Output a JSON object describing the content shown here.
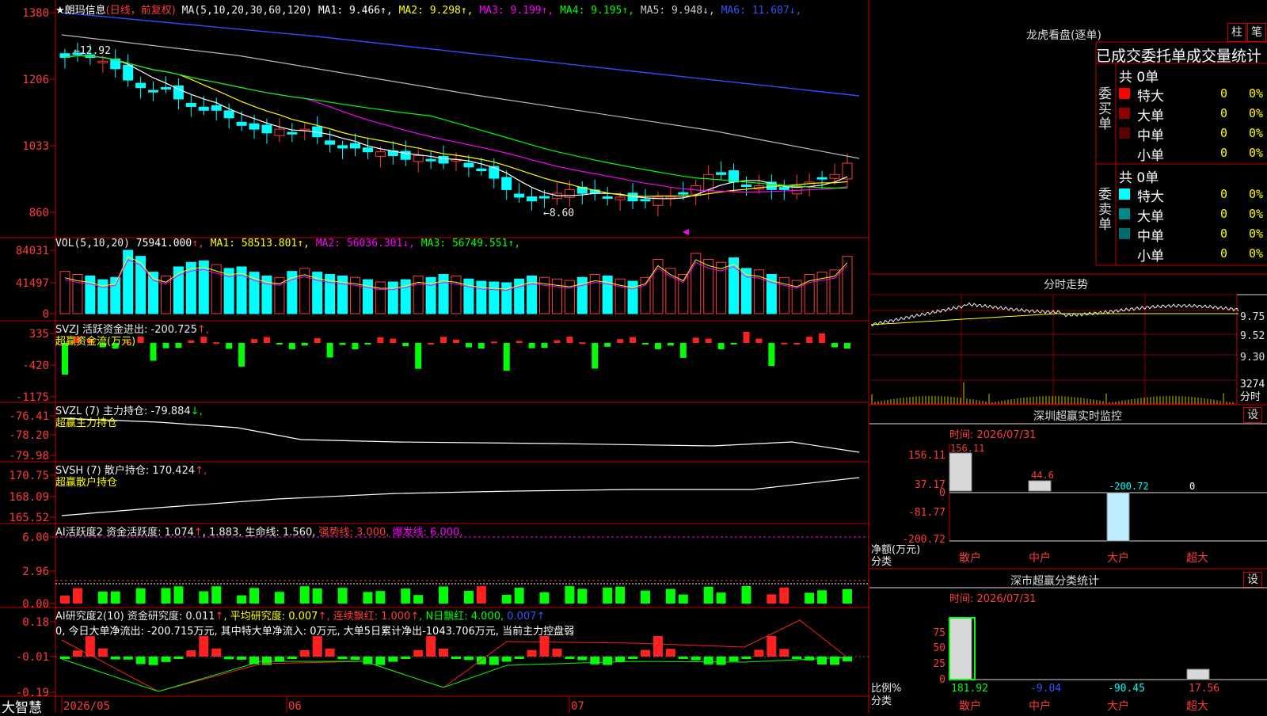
{
  "app": {
    "name": "大智慧"
  },
  "main": {
    "stock_label": "★朗玛信息",
    "period_note": "(日线，前复权)",
    "ma_params": "MA(5,10,20,30,60,120)",
    "ma": [
      {
        "label": "MA1:",
        "value": "9.466",
        "arrow": "↑",
        "color": "#ffffff"
      },
      {
        "label": "MA2:",
        "value": "9.298",
        "arrow": "↑",
        "color": "#ffff00"
      },
      {
        "label": "MA3:",
        "value": "9.199",
        "arrow": "↑",
        "color": "#ff00ff"
      },
      {
        "label": "MA4:",
        "value": "9.195",
        "arrow": "↑",
        "color": "#00ff00"
      },
      {
        "label": "MA5:",
        "value": "9.948",
        "arrow": "↓",
        "color": "#cccccc"
      },
      {
        "label": "MA6:",
        "value": "11.607",
        "arrow": "↓",
        "color": "#3355ff"
      }
    ],
    "y_ticks": [
      "1380",
      "1206",
      "1033",
      "860"
    ],
    "high_label": "←12.92",
    "low_label": "←8.60"
  },
  "vol": {
    "name": "VOL(5,10,20)",
    "value": "75941.000",
    "ma": [
      {
        "label": "MA1:",
        "value": "58513.801",
        "arrow": "↑",
        "color": "#ffff00"
      },
      {
        "label": "MA2:",
        "value": "56036.301",
        "arrow": "↓",
        "color": "#ff00ff"
      },
      {
        "label": "MA3:",
        "value": "56749.551",
        "arrow": "↑",
        "color": "#00ff00"
      }
    ],
    "y_ticks": [
      "84031",
      "41497",
      "0"
    ]
  },
  "svzj": {
    "title": "SVZJ  活跃资金进出: -200.725",
    "subtitle": "超赢资金流(万元)",
    "y_ticks": [
      "335",
      "-420",
      "-1175"
    ]
  },
  "svzl": {
    "title": "SVZL (7) 主力持仓: -79.884",
    "subtitle": "超赢主力持仓",
    "y_ticks": [
      "-76.41",
      "-78.20",
      "-79.98"
    ]
  },
  "svsh": {
    "title": "SVSH (7) 散户持仓: 170.424",
    "subtitle": "超赢散户持仓",
    "y_ticks": [
      "170.75",
      "168.09",
      "165.52"
    ]
  },
  "ai_act": {
    "title_a": "AI活跃度2 资金活跃度: 1.074",
    "title_b": ", 1.883, 生命线: 1.560,",
    "strong": "强势线: 3.000,",
    "burst": "爆发线: 6.000,",
    "y_ticks": [
      "6.00",
      "2.96",
      "0.00"
    ]
  },
  "ai_res": {
    "title_a": "AI研究度2(10) 资金研究度: 0.011",
    "avg": ", 平均研究度: 0.007",
    "streak": ", 连续飘红: 1.000",
    "nday": ", N日飘红: 4.000,",
    "tail": "0.007",
    "comment": "0, 今日大单净流出: -200.715万元, 其中特大单净流入: 0万元, 大单5日累计净出-1043.706万元, 当前主力控盘弱",
    "y_ticks": [
      "0.18",
      "-0.01",
      "-0.19"
    ]
  },
  "xaxis": {
    "labels": [
      "2026/05",
      "06",
      "07"
    ]
  },
  "right": {
    "lhb_title": "龙虎看盘(逐单)",
    "btn_zhu": "柱",
    "btn_bi": "笔",
    "stat_title": "已成交委托单成交量统计",
    "buy_side": {
      "label": "委买单",
      "total": "共 0单",
      "rows": [
        {
          "name": "特大",
          "val": "0",
          "pct": "0%",
          "color": "#ff0000"
        },
        {
          "name": "大单",
          "val": "0",
          "pct": "0%",
          "color": "#8b0000"
        },
        {
          "name": "中单",
          "val": "0",
          "pct": "0%",
          "color": "#5a0000"
        },
        {
          "name": "小单",
          "val": "0",
          "pct": "0%",
          "color": ""
        }
      ]
    },
    "sell_side": {
      "label": "委卖单",
      "total": "共 0单",
      "rows": [
        {
          "name": "特大",
          "val": "0",
          "pct": "0%",
          "color": "#00ffff"
        },
        {
          "name": "大单",
          "val": "0",
          "pct": "0%",
          "color": "#008b8b"
        },
        {
          "name": "中单",
          "val": "0",
          "pct": "0%",
          "color": "#006b6b"
        },
        {
          "name": "小单",
          "val": "0",
          "pct": "0%",
          "color": ""
        }
      ]
    },
    "intraday_title": "分时走势",
    "intraday_y": [
      "9.75",
      "9.52",
      "9.30",
      "3274",
      "分时"
    ],
    "monitor": {
      "title": "深圳超赢实时监控",
      "set": "设",
      "time": "时间: 2026/07/31",
      "y_ticks": [
        "156.11",
        "37.17",
        "0",
        "-81.77",
        "-200.72"
      ],
      "y_label": "净额(万元)",
      "x_label": "分类",
      "categories": [
        "散户",
        "中户",
        "大户",
        "超大"
      ],
      "bar_labels": [
        "156.11",
        "44.6",
        "-200.72",
        "0"
      ]
    },
    "classify": {
      "title": "深市超赢分类统计",
      "set": "设",
      "time": "时间: 2026/07/31",
      "y_ticks": [
        "75",
        "50",
        "25",
        "0"
      ],
      "y_label": "比例%",
      "x_label": "分类",
      "categories": [
        "散户",
        "中户",
        "大户",
        "超大"
      ],
      "values": [
        "181.92",
        "-9.04",
        "-90.45",
        "17.56"
      ]
    }
  },
  "chart_data": [
    {
      "type": "candlestick",
      "title": "朗玛信息 (日线，前复权)",
      "x": [
        "2026/05",
        "06",
        "07"
      ],
      "ylim": [
        8.6,
        12.92
      ],
      "ohlc_close_approx": [
        12.7,
        12.8,
        12.7,
        12.6,
        12.4,
        12.1,
        11.9,
        11.8,
        11.9,
        11.6,
        11.4,
        11.3,
        11.3,
        11.1,
        10.9,
        10.8,
        10.7,
        10.8,
        10.7,
        10.8,
        10.6,
        10.4,
        10.3,
        10.3,
        10.2,
        10.2,
        10.1,
        10.0,
        10.1,
        10.0,
        9.9,
        10.0,
        9.8,
        9.7,
        9.5,
        9.2,
        9.0,
        8.9,
        9.0,
        9.1,
        9.2,
        9.1,
        9.1,
        9.0,
        9.0,
        8.9,
        8.9,
        9.0,
        9.0,
        9.1,
        9.3,
        9.6,
        9.6,
        9.4,
        9.3,
        9.3,
        9.2,
        9.2,
        9.3,
        9.4,
        9.5,
        9.6,
        9.9
      ],
      "series": [
        {
          "name": "MA1",
          "last": 9.466
        },
        {
          "name": "MA2",
          "last": 9.298
        },
        {
          "name": "MA3",
          "last": 9.199
        },
        {
          "name": "MA4",
          "last": 9.195
        },
        {
          "name": "MA5",
          "last": 9.948
        },
        {
          "name": "MA6",
          "last": 11.607
        }
      ]
    },
    {
      "type": "bar",
      "title": "VOL(5,10,20)",
      "ylim": [
        0,
        84031
      ],
      "values": [
        56000,
        52000,
        50000,
        45000,
        48000,
        84031,
        76000,
        55000,
        50000,
        62000,
        68000,
        70000,
        65000,
        60000,
        62000,
        55000,
        50000,
        48000,
        56000,
        60000,
        55000,
        52000,
        50000,
        48000,
        45000,
        42000,
        42000,
        45000,
        50000,
        48000,
        52000,
        50000,
        46000,
        43000,
        42000,
        41000,
        46000,
        50000,
        48000,
        46000,
        44000,
        48000,
        52000,
        50000,
        46000,
        43000,
        48000,
        72000,
        60000,
        52000,
        80000,
        72000,
        68000,
        74000,
        60000,
        58000,
        52000,
        48000,
        44000,
        52000,
        55000,
        58000,
        75941
      ],
      "last": 75941.0
    },
    {
      "type": "bar",
      "title": "超赢资金流(万元)",
      "ylim": [
        -1175,
        335
      ],
      "last": -200.725
    },
    {
      "type": "line",
      "title": "超赢主力持仓",
      "ylim": [
        -79.98,
        -76.41
      ],
      "last": -79.884
    },
    {
      "type": "line",
      "title": "超赢散户持仓",
      "ylim": [
        165.52,
        170.75
      ],
      "last": 170.424
    },
    {
      "type": "bar",
      "title": "AI活跃度2",
      "ylim": [
        0,
        6.0
      ],
      "last": 1.074
    },
    {
      "type": "bar",
      "title": "AI研究度2(10)",
      "ylim": [
        -0.19,
        0.18
      ],
      "last": 0.011
    },
    {
      "type": "bar",
      "title": "深圳超赢实时监控",
      "categories": [
        "散户",
        "中户",
        "大户",
        "超大"
      ],
      "values": [
        156.11,
        44.6,
        -200.72,
        0
      ],
      "ylim": [
        -200.72,
        156.11
      ]
    },
    {
      "type": "bar",
      "title": "深市超赢分类统计",
      "categories": [
        "散户",
        "中户",
        "大户",
        "超大"
      ],
      "values": [
        181.92,
        -9.04,
        -90.45,
        17.56
      ],
      "ylim": [
        0,
        100
      ]
    }
  ]
}
